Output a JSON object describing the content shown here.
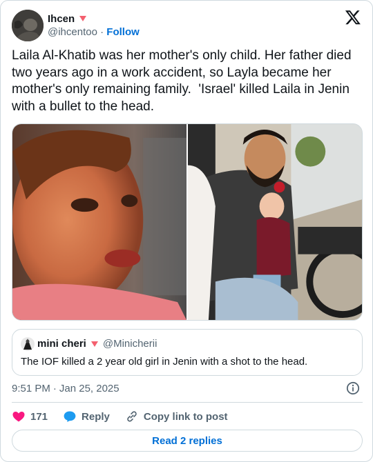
{
  "author": {
    "name": "Ihcen",
    "handle": "@ihcentoo",
    "separator": "·",
    "follow_label": "Follow"
  },
  "tweet": {
    "text": "Laila Al-Khatib was her mother's only child. Her father died two years ago in a work accident, so Layla became her mother's only remaining family.  'Israel' killed Laila in Jenin with a bullet to the head."
  },
  "quote": {
    "name": "mini cheri",
    "handle": "@Minicherii",
    "text": "The IOF killed a 2 year old girl in Jenin with a shot to the head."
  },
  "meta": {
    "time": "9:51 PM",
    "separator": "·",
    "date": "Jan 25, 2025"
  },
  "actions": {
    "like_count": "171",
    "reply_label": "Reply",
    "copy_label": "Copy link to post"
  },
  "replies_button": "Read 2 replies",
  "colors": {
    "accent": "#006fd6",
    "heart": "#f91880",
    "reply_bubble": "#1d9bf0",
    "muted": "#536471",
    "border": "#cfd9de"
  },
  "icons": [
    "heart-icon",
    "x-logo-icon",
    "info-icon",
    "reply-icon",
    "link-icon"
  ]
}
